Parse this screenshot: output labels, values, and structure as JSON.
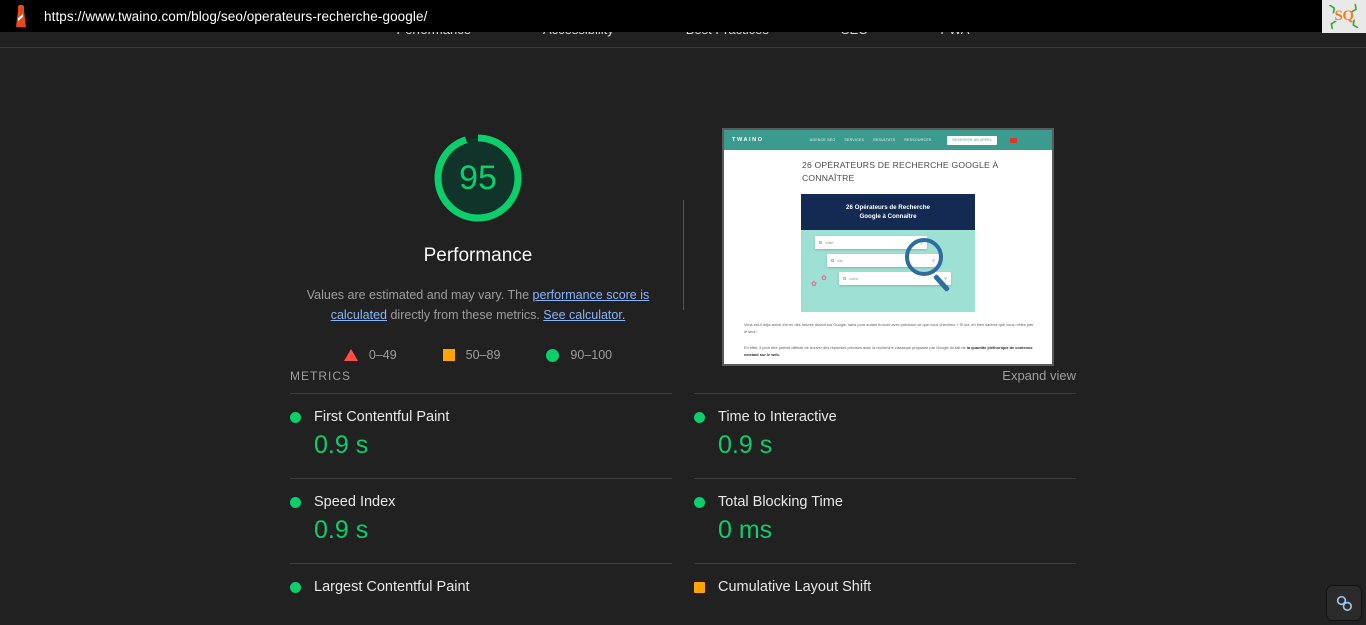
{
  "browser": {
    "url": "https://www.twaino.com/blog/seo/operateurs-recherche-google/",
    "favicon_name": "lighthouse-icon"
  },
  "badge": {
    "text": "SQ",
    "leaf": "❯"
  },
  "nav": {
    "tabs": [
      {
        "label": "Performance"
      },
      {
        "label": "Accessibility"
      },
      {
        "label": "Best Practices"
      },
      {
        "label": "SEO"
      },
      {
        "label": "PWA"
      }
    ]
  },
  "gauge": {
    "score": "95",
    "score_number": 95,
    "label": "Performance",
    "color": "#0cce6b",
    "track_color": "#11342a",
    "desc_part1": "Values are estimated and may vary. The ",
    "desc_link1": "performance score is calculated",
    "desc_part2": " directly from these metrics. ",
    "desc_link2": "See calculator."
  },
  "legend": {
    "items": [
      {
        "shape": "triangle",
        "label": "0–49",
        "color": "#ff4e42"
      },
      {
        "shape": "square",
        "label": "50–89",
        "color": "#ffa400"
      },
      {
        "shape": "circle",
        "label": "90–100",
        "color": "#0cce6b"
      }
    ]
  },
  "thumbnail": {
    "logo": "TWAINO",
    "menu": [
      "AGENCE SEO",
      "SERVICES",
      "RESULTATS",
      "RESSOURCES"
    ],
    "cta": "RESERVER UN APPEL",
    "title": "26 OPÉRATEURS DE RECHERCHE GOOGLE À CONNAÎTRE",
    "hero_title_line1": "26 Opérateurs de Recherche",
    "hero_title_line2": "Google à Connaître",
    "search_queries": [
      "intitle:",
      "site:",
      "cache:"
    ],
    "para1": "Vous est-il déjà arrivé d'errer des heures durant sur Google, sans pour autant trouver avec précision ce que vous cherchez ? Si oui, eh bien sachez que vous n'êtes pas le seul !",
    "para2_a": "En effet, il peut être parfois difficile de trouver des réponses précises avec la recherche classique proposée par Google du fait de ",
    "para2_b": "la quantité pléthorique de contenus existant sur le web."
  },
  "metrics": {
    "title": "METRICS",
    "expand_label": "Expand view",
    "items": [
      {
        "name": "First Contentful Paint",
        "value": "0.9 s",
        "status": "pass",
        "shape": "circle",
        "color": "#0cce6b"
      },
      {
        "name": "Time to Interactive",
        "value": "0.9 s",
        "status": "pass",
        "shape": "circle",
        "color": "#0cce6b"
      },
      {
        "name": "Speed Index",
        "value": "0.9 s",
        "status": "pass",
        "shape": "circle",
        "color": "#0cce6b"
      },
      {
        "name": "Total Blocking Time",
        "value": "0 ms",
        "status": "pass",
        "shape": "circle",
        "color": "#0cce6b"
      },
      {
        "name": "Largest Contentful Paint",
        "value": "",
        "status": "pass",
        "shape": "circle",
        "color": "#0cce6b"
      },
      {
        "name": "Cumulative Layout Shift",
        "value": "",
        "status": "average",
        "shape": "square",
        "color": "#ffa400"
      }
    ]
  },
  "fab": {
    "icon": "link-icon",
    "color": "#9cc3e8"
  }
}
